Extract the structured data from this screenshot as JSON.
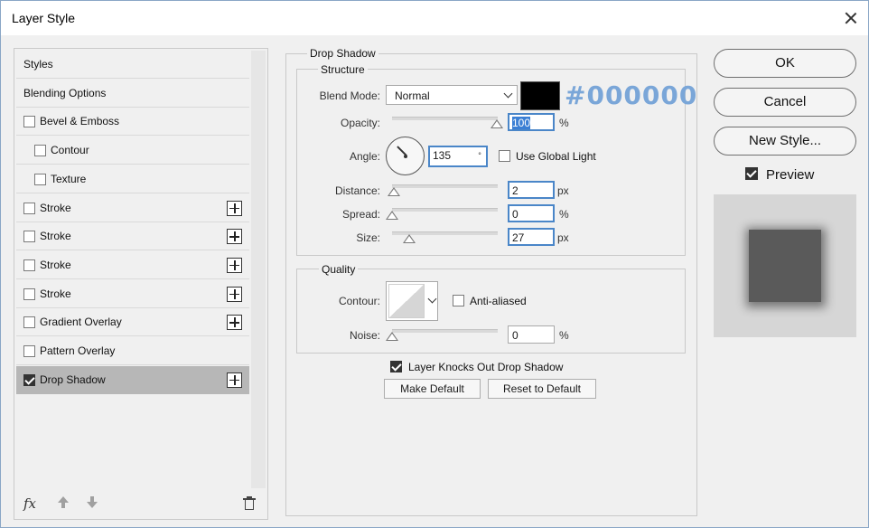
{
  "window": {
    "title": "Layer Style"
  },
  "sidebar": {
    "items": [
      {
        "label": "Styles",
        "has_checkbox": false,
        "checked": false,
        "has_add": false
      },
      {
        "label": "Blending Options",
        "has_checkbox": false,
        "checked": false,
        "has_add": false
      },
      {
        "label": "Bevel & Emboss",
        "has_checkbox": true,
        "checked": false,
        "has_add": false
      },
      {
        "label": "Contour",
        "has_checkbox": true,
        "checked": false,
        "has_add": false
      },
      {
        "label": "Texture",
        "has_checkbox": true,
        "checked": false,
        "has_add": false
      },
      {
        "label": "Stroke",
        "has_checkbox": true,
        "checked": false,
        "has_add": true
      },
      {
        "label": "Stroke",
        "has_checkbox": true,
        "checked": false,
        "has_add": true
      },
      {
        "label": "Stroke",
        "has_checkbox": true,
        "checked": false,
        "has_add": true
      },
      {
        "label": "Stroke",
        "has_checkbox": true,
        "checked": false,
        "has_add": true
      },
      {
        "label": "Gradient Overlay",
        "has_checkbox": true,
        "checked": false,
        "has_add": true
      },
      {
        "label": "Pattern Overlay",
        "has_checkbox": true,
        "checked": false,
        "has_add": false
      },
      {
        "label": "Drop Shadow",
        "has_checkbox": true,
        "checked": true,
        "has_add": true,
        "selected": true
      }
    ],
    "fx_label": "fx"
  },
  "drop_shadow": {
    "section_title": "Drop Shadow",
    "structure": {
      "title": "Structure",
      "blend_mode_label": "Blend Mode:",
      "blend_mode_value": "Normal",
      "color": "#000000",
      "color_hex_label": "#000000",
      "opacity_label": "Opacity:",
      "opacity_value": "100",
      "opacity_unit": "%",
      "angle_label": "Angle:",
      "angle_value": "135",
      "angle_unit": "°",
      "use_global_light_label": "Use Global Light",
      "use_global_light": false,
      "distance_label": "Distance:",
      "distance_value": "2",
      "distance_unit": "px",
      "spread_label": "Spread:",
      "spread_value": "0",
      "spread_unit": "%",
      "size_label": "Size:",
      "size_value": "27",
      "size_unit": "px"
    },
    "quality": {
      "title": "Quality",
      "contour_label": "Contour:",
      "anti_aliased_label": "Anti-aliased",
      "anti_aliased": false,
      "noise_label": "Noise:",
      "noise_value": "0",
      "noise_unit": "%"
    },
    "knockout_label": "Layer Knocks Out Drop Shadow",
    "knockout": true,
    "make_default_label": "Make Default",
    "reset_default_label": "Reset to Default"
  },
  "actions": {
    "ok_label": "OK",
    "cancel_label": "Cancel",
    "new_style_label": "New Style...",
    "preview_label": "Preview",
    "preview_checked": true
  }
}
